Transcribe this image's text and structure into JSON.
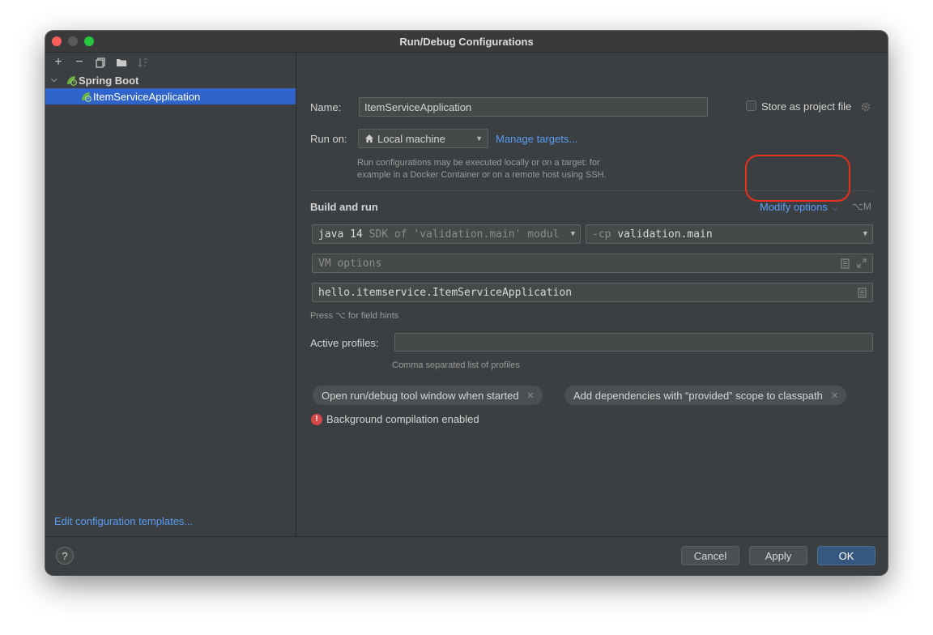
{
  "window": {
    "title": "Run/Debug Configurations"
  },
  "left": {
    "toolbar": {
      "add": "+",
      "remove": "−",
      "copy": "⧉",
      "folder": "▰",
      "sort": "↓a"
    },
    "tree": {
      "group_label": "Spring Boot",
      "child_label": "ItemServiceApplication"
    },
    "edit_templates_link": "Edit configuration templates..."
  },
  "right": {
    "name_label": "Name:",
    "name_value": "ItemServiceApplication",
    "store_as_project_file": "Store as project file",
    "run_on_label": "Run on:",
    "run_on_value": "Local machine",
    "manage_targets": "Manage targets...",
    "run_on_hint_line1": "Run configurations may be executed locally or on a target: for",
    "run_on_hint_line2": "example in a Docker Container or on a remote host using SSH.",
    "build_and_run": "Build and run",
    "modify_options": "Modify options",
    "modify_options_shortcut": "⌥M",
    "sdk_combo": {
      "prefix": "java 14",
      "rest": " SDK of 'validation.main' modul"
    },
    "classpath_combo": {
      "prefix": "-cp ",
      "value": "validation.main"
    },
    "vm_options_placeholder": "VM options",
    "main_class_value": "hello.itemservice.ItemServiceApplication",
    "field_hints": "Press ⌥ for field hints",
    "active_profiles_label": "Active profiles:",
    "active_profiles_value": "",
    "active_profiles_hint": "Comma separated list of profiles",
    "chips": [
      "Open run/debug tool window when started",
      "Add dependencies with “provided” scope to classpath"
    ],
    "background_compilation": "Background compilation enabled"
  },
  "bottom": {
    "help": "?",
    "cancel": "Cancel",
    "apply": "Apply",
    "ok": "OK"
  },
  "colors": {
    "window_bg": "#3c3f41",
    "selection": "#2f65ca",
    "link": "#589df6",
    "highlight_ring": "#e8301f",
    "primary_button": "#365880"
  }
}
